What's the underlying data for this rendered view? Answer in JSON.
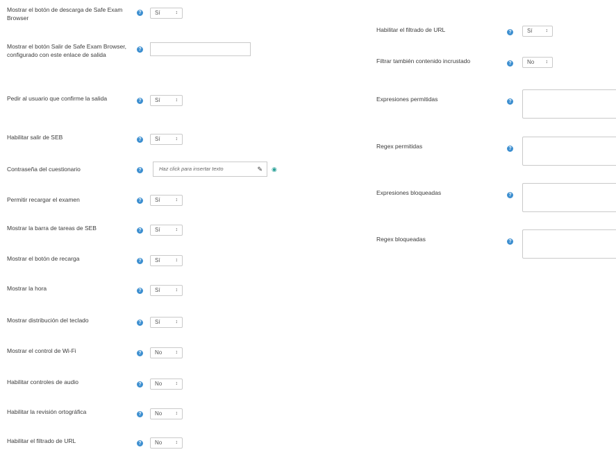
{
  "left": {
    "rows": [
      {
        "label": "Mostrar el botón de descarga de Safe Exam Browser",
        "value": "Sí"
      },
      {
        "label": "Mostrar el botón Salir de Safe Exam Browser, configurado con este enlace de salida",
        "value": ""
      },
      {
        "label": "Pedir al usuario que confirme la salida",
        "value": "Sí"
      },
      {
        "label": "Habilitar salir de SEB",
        "value": "Sí"
      },
      {
        "label": "Contraseña del cuestionario",
        "placeholder": "Haz click para insertar texto"
      },
      {
        "label": "Permitir recargar el examen",
        "value": "Sí"
      },
      {
        "label": "Mostrar la barra de tareas de SEB",
        "value": "Sí"
      },
      {
        "label": "Mostrar el botón de recarga",
        "value": "Sí"
      },
      {
        "label": "Mostrar la hora",
        "value": "Sí"
      },
      {
        "label": "Mostrar distribución del teclado",
        "value": "Sí"
      },
      {
        "label": "Mostrar el control de Wi-Fi",
        "value": "No"
      },
      {
        "label": "Habilitar controles de audio",
        "value": "No"
      },
      {
        "label": "Habilitar la revisión ortográfica",
        "value": "No"
      },
      {
        "label": "Habilitar el filtrado de URL",
        "value": "No"
      }
    ]
  },
  "right": {
    "rows": [
      {
        "label": "Habilitar el filtrado de URL",
        "value": "Sí"
      },
      {
        "label": "Filtrar también contenido incrustado",
        "value": "No"
      },
      {
        "label": "Expresiones permitidas",
        "value": ""
      },
      {
        "label": "Regex permitidas",
        "value": ""
      },
      {
        "label": "Expresiones bloqueadas",
        "value": ""
      },
      {
        "label": "Regex bloqueadas",
        "value": ""
      }
    ]
  },
  "icons": {
    "help": "question-circle-icon",
    "caret": "select-caret-icon",
    "pencil": "pencil-icon",
    "eye": "eye-icon"
  },
  "colors": {
    "help_icon": "#3d8fd0",
    "eye_icon": "#2aa198",
    "border": "#c9c9c9"
  }
}
